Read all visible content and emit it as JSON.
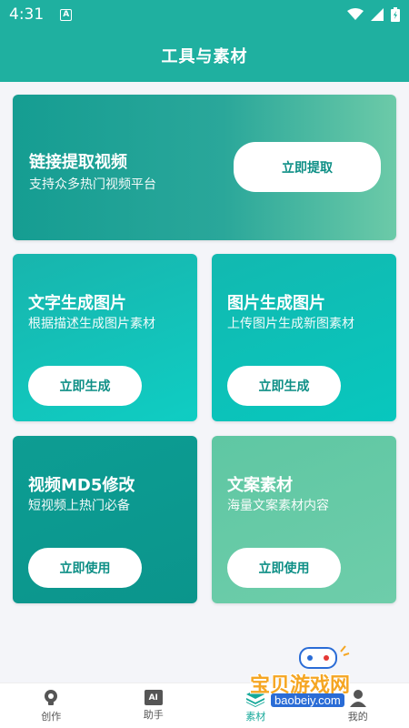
{
  "status": {
    "time": "4:31",
    "notif_letter": "A"
  },
  "app_bar": {
    "title": "工具与素材"
  },
  "top_card": {
    "title": "链接提取视频",
    "subtitle": "支持众多热门视频平台",
    "button": "立即提取"
  },
  "cards": [
    {
      "title": "文字生成图片",
      "subtitle": "根据描述生成图片素材",
      "button": "立即生成"
    },
    {
      "title": "图片生成图片",
      "subtitle": "上传图片生成新图素材",
      "button": "立即生成"
    },
    {
      "title": "视频MD5修改",
      "subtitle": "短视频上热门必备",
      "button": "立即使用"
    },
    {
      "title": "文案素材",
      "subtitle": "海量文案素材内容",
      "button": "立即使用"
    }
  ],
  "tabs": [
    {
      "label": "创作",
      "icon": "bulb-icon"
    },
    {
      "label": "助手",
      "icon": "ai-icon",
      "icon_text": "AI"
    },
    {
      "label": "素材",
      "icon": "layers-icon",
      "active": true
    },
    {
      "label": "我的",
      "icon": "person-icon"
    }
  ],
  "watermark": {
    "text": "宝贝游戏网",
    "url": "baobeiy.com"
  },
  "colors": {
    "primary": "#1fb0a0",
    "button_text": "#0e8f86"
  }
}
